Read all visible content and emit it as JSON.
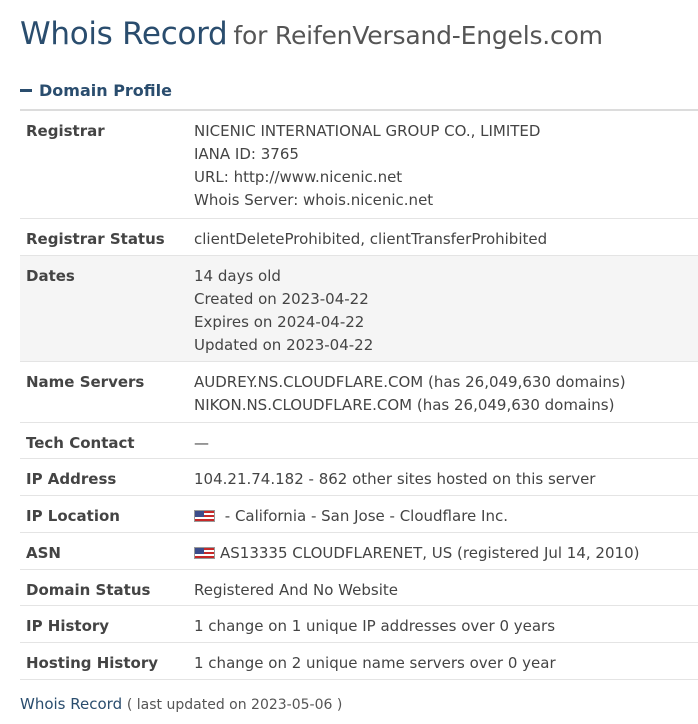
{
  "header": {
    "title": "Whois Record",
    "subtitle": "for ReifenVersand-Engels.com"
  },
  "section": {
    "label": "Domain Profile",
    "icon": "minus-icon"
  },
  "rows": {
    "registrar": {
      "label": "Registrar",
      "lines": [
        "NICENIC INTERNATIONAL GROUP CO., LIMITED",
        "IANA ID: 3765",
        "URL: http://www.nicenic.net",
        "Whois Server: whois.nicenic.net"
      ]
    },
    "registrar_status": {
      "label": "Registrar Status",
      "value": "clientDeleteProhibited, clientTransferProhibited"
    },
    "dates": {
      "label": "Dates",
      "lines": [
        "14 days old",
        "Created on 2023-04-22",
        "Expires on 2024-04-22",
        "Updated on 2023-04-22"
      ]
    },
    "name_servers": {
      "label": "Name Servers",
      "lines": [
        "AUDREY.NS.CLOUDFLARE.COM (has 26,049,630 domains)",
        "NIKON.NS.CLOUDFLARE.COM (has 26,049,630 domains)"
      ]
    },
    "tech_contact": {
      "label": "Tech Contact",
      "value": "—"
    },
    "ip_address": {
      "label": "IP Address",
      "value": "104.21.74.182 - 862 other sites hosted on this server"
    },
    "ip_location": {
      "label": "IP Location",
      "value": " - California - San Jose - Cloudflare Inc.",
      "flag": "us-flag-icon"
    },
    "asn": {
      "label": "ASN",
      "value": "AS13335 CLOUDFLARENET, US (registered Jul 14, 2010)",
      "flag": "us-flag-icon"
    },
    "domain_status": {
      "label": "Domain Status",
      "value": "Registered And No Website"
    },
    "ip_history": {
      "label": "IP History",
      "value": "1 change on 1 unique IP addresses over 0 years"
    },
    "hosting_history": {
      "label": "Hosting History",
      "value": "1 change on 2 unique name servers over 0 year"
    }
  },
  "footer": {
    "link": "Whois Record",
    "note": "( last updated on 2023-05-06 )"
  },
  "colors": {
    "accent": "#2a4d6e",
    "text": "#444444",
    "alt_row": "#f5f5f5",
    "border": "#e4e4e4"
  }
}
